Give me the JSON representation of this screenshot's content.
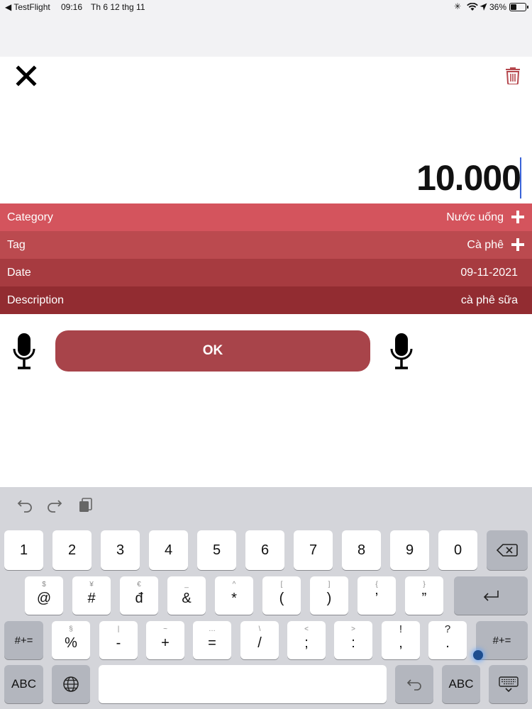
{
  "status_bar": {
    "back_app": "TestFlight",
    "time": "09:16",
    "date": "Th 6 12 thg 11",
    "battery": "36%"
  },
  "header": {
    "close_icon": "close-icon",
    "delete_icon": "trash-icon"
  },
  "amount": "10.000",
  "fields": [
    {
      "label": "Category",
      "value": "Nước uống",
      "color": "#d4545d",
      "has_add": true
    },
    {
      "label": "Tag",
      "value": "Cà phê",
      "color": "#bb4a4f",
      "has_add": true
    },
    {
      "label": "Date",
      "value": "09-11-2021",
      "color": "#a73b40",
      "has_add": false
    },
    {
      "label": "Description",
      "value": "cà phê sữa",
      "color": "#922c31",
      "has_add": false
    }
  ],
  "ok_label": "OK",
  "accent_color": "#a8444a",
  "keyboard": {
    "row1": [
      "1",
      "2",
      "3",
      "4",
      "5",
      "6",
      "7",
      "8",
      "9",
      "0"
    ],
    "row2": [
      {
        "sub": "$",
        "main": "@"
      },
      {
        "sub": "¥",
        "main": "#"
      },
      {
        "sub": "€",
        "main": "đ"
      },
      {
        "sub": "_",
        "main": "&"
      },
      {
        "sub": "^",
        "main": "*"
      },
      {
        "sub": "[",
        "main": "("
      },
      {
        "sub": "]",
        "main": ")"
      },
      {
        "sub": "{",
        "main": "’"
      },
      {
        "sub": "}",
        "main": "”"
      }
    ],
    "row3": [
      {
        "sub": "§",
        "main": "%"
      },
      {
        "sub": "|",
        "main": "-"
      },
      {
        "sub": "~",
        "main": "+"
      },
      {
        "sub": "…",
        "main": "="
      },
      {
        "sub": "\\",
        "main": "/"
      },
      {
        "sub": "<",
        "main": ";"
      },
      {
        "sub": ">",
        "main": ":"
      },
      {
        "sub": "!",
        "main": ","
      },
      {
        "sub": "?",
        "main": "."
      }
    ],
    "shift_label": "#+=",
    "abc_label": "ABC"
  }
}
